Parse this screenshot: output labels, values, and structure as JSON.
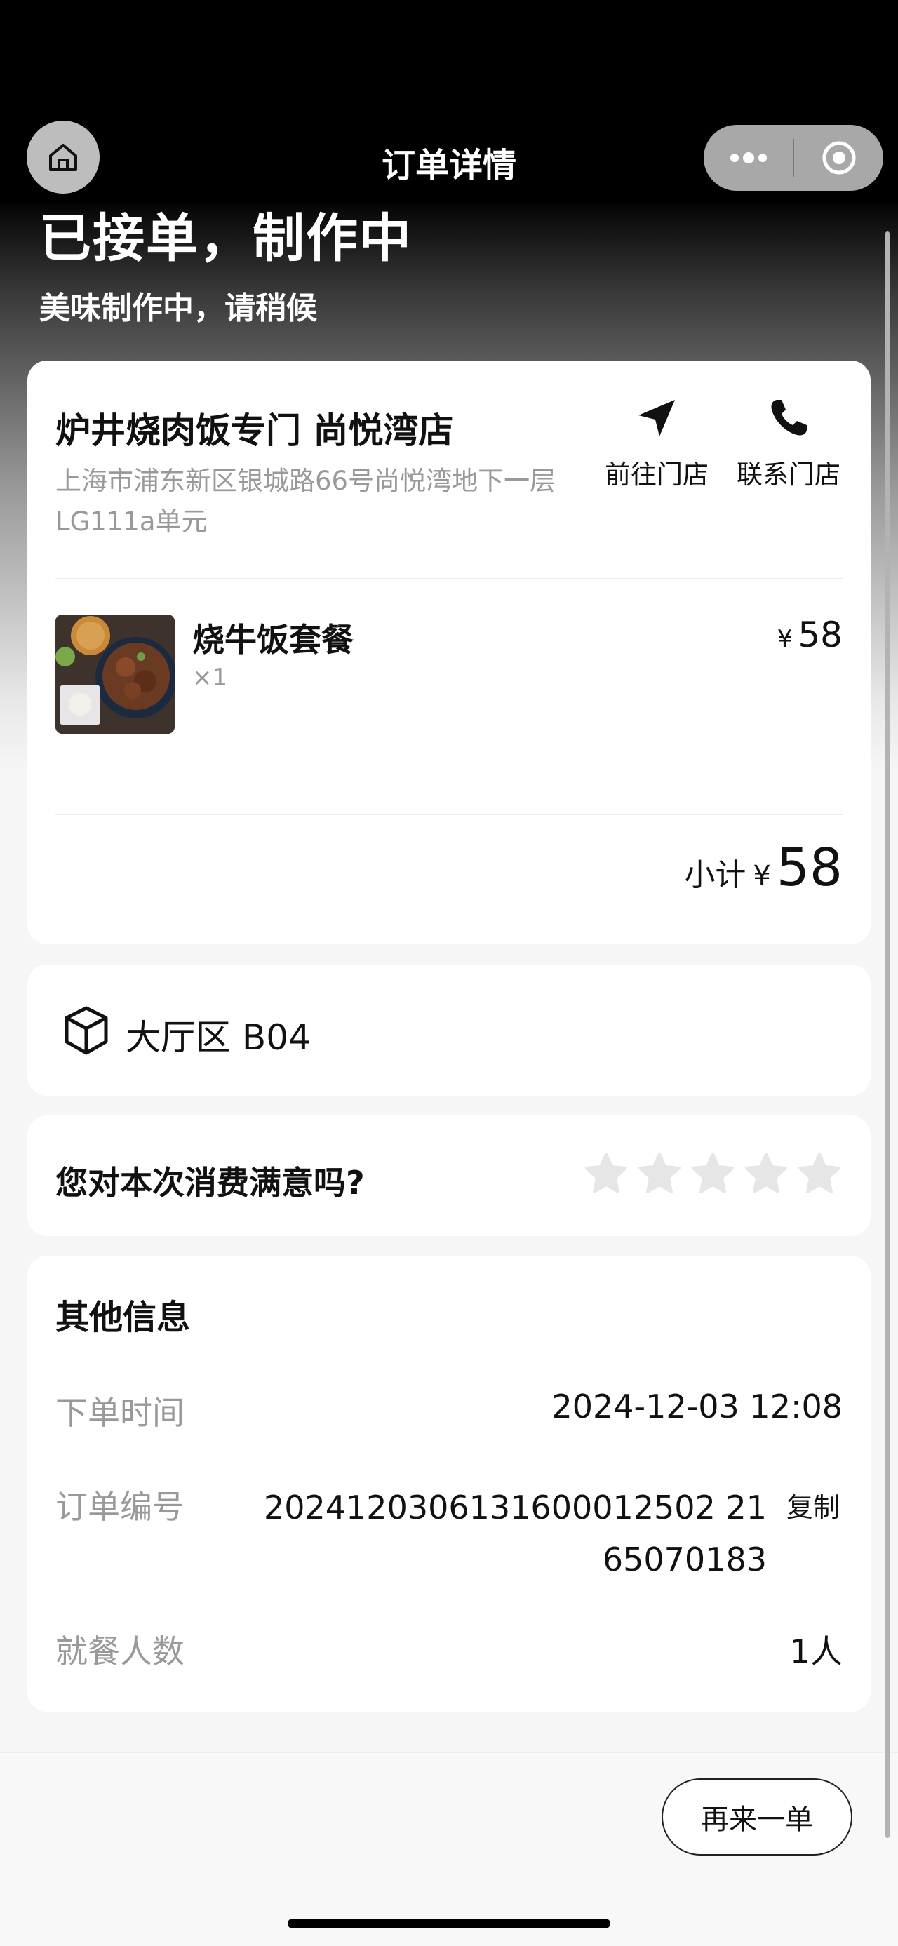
{
  "nav": {
    "title": "订单详情"
  },
  "status": {
    "title": "已接单，制作中",
    "subtitle": "美味制作中，请稍候"
  },
  "store": {
    "name": "炉井烧肉饭专门 尚悦湾店",
    "address": "上海市浦东新区银城路66号尚悦湾地下一层LG111a单元",
    "navigate_label": "前往门店",
    "call_label": "联系门店"
  },
  "order_item": {
    "name": "烧牛饭套餐",
    "quantity": "×1",
    "currency": "¥",
    "price": "58"
  },
  "subtotal": {
    "label": "小计",
    "currency": "¥",
    "value": "58"
  },
  "table": {
    "label": "大厅区 B04"
  },
  "rating": {
    "question": "您对本次消费满意吗?",
    "stars": 5,
    "selected": 0,
    "star_color": "#e6e6e6"
  },
  "other_info": {
    "title": "其他信息",
    "order_time_label": "下单时间",
    "order_time_value": "2024-12-03 12:08",
    "order_no_label": "订单编号",
    "order_no_line1": "2024120306131600012502 21",
    "order_no_line2": "65070183",
    "copy_label": "复制",
    "diners_label": "就餐人数",
    "diners_value": "1人"
  },
  "bottom": {
    "reorder_label": "再来一单"
  },
  "colors": {
    "header_bg": "#000000",
    "muted_text": "#999999",
    "card_bg": "#ffffff"
  }
}
